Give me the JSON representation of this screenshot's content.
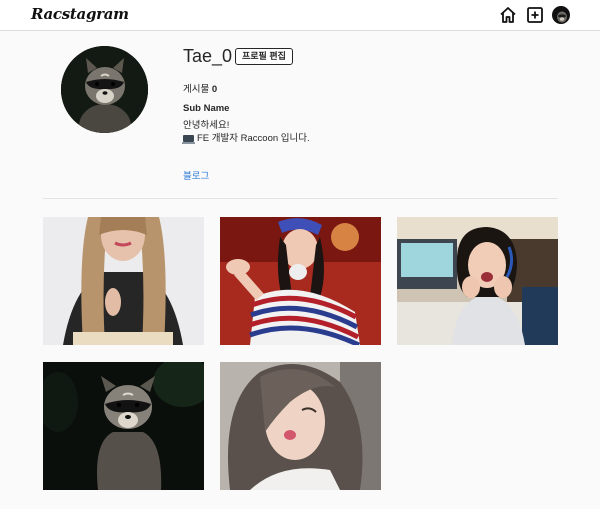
{
  "header": {
    "logo": "Racstagram",
    "icons": [
      "home-icon",
      "add-post-icon",
      "profile-avatar"
    ]
  },
  "profile": {
    "username": "Tae_0",
    "edit_button": "프로필 편집",
    "posts_label": "게시물",
    "posts_count": "0",
    "sub_name": "Sub Name",
    "bio_line1": "안녕하세요!",
    "bio_line2": "FE 개발자 Raccoon 입니다.",
    "blog_link": "블로그"
  },
  "posts": [
    {
      "subject": "long-haired woman in black top"
    },
    {
      "subject": "woman in striped top dancing"
    },
    {
      "subject": "woman smiling with hands on cheeks"
    },
    {
      "subject": "raccoon at night"
    },
    {
      "subject": "woman selfie with pout"
    }
  ],
  "colors": {
    "background": "#fafafa",
    "header_bg": "#ffffff",
    "link": "#2d7ad6",
    "border": "#dbdbdb"
  }
}
